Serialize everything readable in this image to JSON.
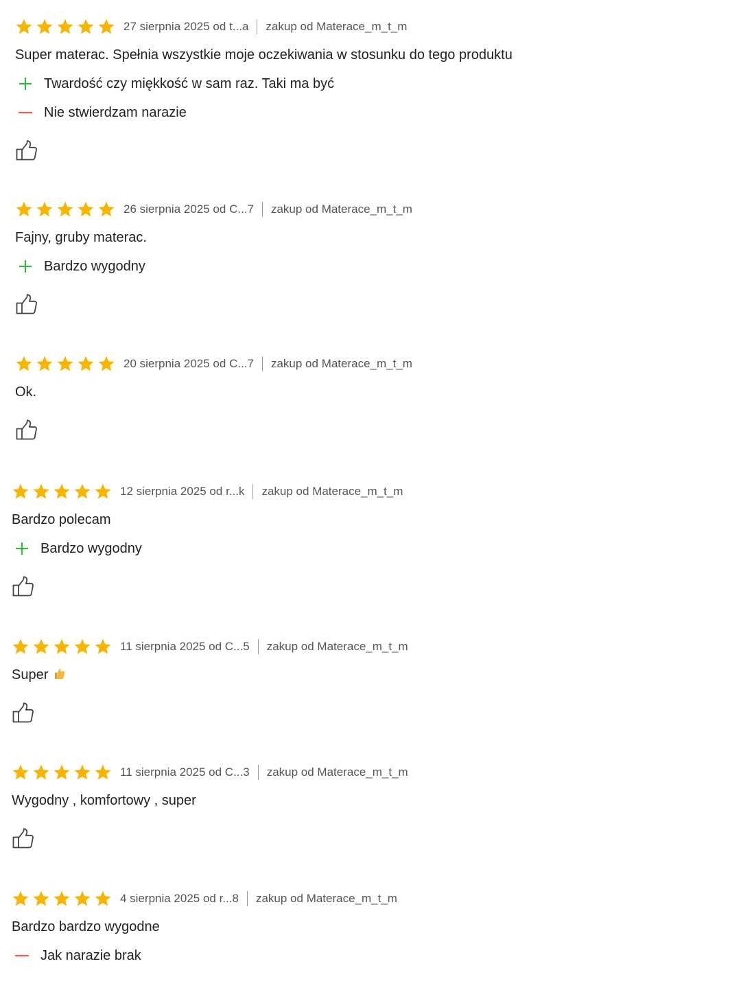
{
  "colors": {
    "star": "#f7b500",
    "plus": "#3bb54a",
    "minus": "#f25c54",
    "meta_text": "#555555",
    "body_text": "#222222"
  },
  "icons": {
    "star": "star-icon",
    "plus": "plus-icon",
    "minus": "minus-icon",
    "like": "thumbs-up-icon",
    "emoji": "thumbs-up-emoji-icon"
  },
  "reviews": [
    {
      "rating": 5,
      "date_author": "27 sierpnia 2025 od t...a",
      "seller": "zakup od Materace_m_t_m",
      "text": "Super materac. Spełnia wszystkie moje oczekiwania w stosunku do tego produktu",
      "pros": "Twardość czy miękkość w sam raz. Taki ma być",
      "cons": "Nie stwierdzam narazie"
    },
    {
      "rating": 5,
      "date_author": "26 sierpnia 2025 od C...7",
      "seller": "zakup od Materace_m_t_m",
      "text": "Fajny, gruby materac.",
      "pros": "Bardzo wygodny"
    },
    {
      "rating": 5,
      "date_author": "20 sierpnia 2025 od C...7",
      "seller": "zakup od Materace_m_t_m",
      "text": "Ok."
    },
    {
      "rating": 5,
      "date_author": "12 sierpnia 2025 od r...k",
      "seller": "zakup od Materace_m_t_m",
      "text": "Bardzo polecam",
      "pros": "Bardzo wygodny"
    },
    {
      "rating": 5,
      "date_author": "11 sierpnia 2025 od C...5",
      "seller": "zakup od Materace_m_t_m",
      "text": "Super"
    },
    {
      "rating": 5,
      "date_author": "11 sierpnia 2025 od C...3",
      "seller": "zakup od Materace_m_t_m",
      "text": "Wygodny , komfortowy , super"
    },
    {
      "rating": 5,
      "date_author": "4 sierpnia 2025 od r...8",
      "seller": "zakup od Materace_m_t_m",
      "text": "Bardzo bardzo wygodne",
      "cons": "Jak narazie brak"
    }
  ]
}
